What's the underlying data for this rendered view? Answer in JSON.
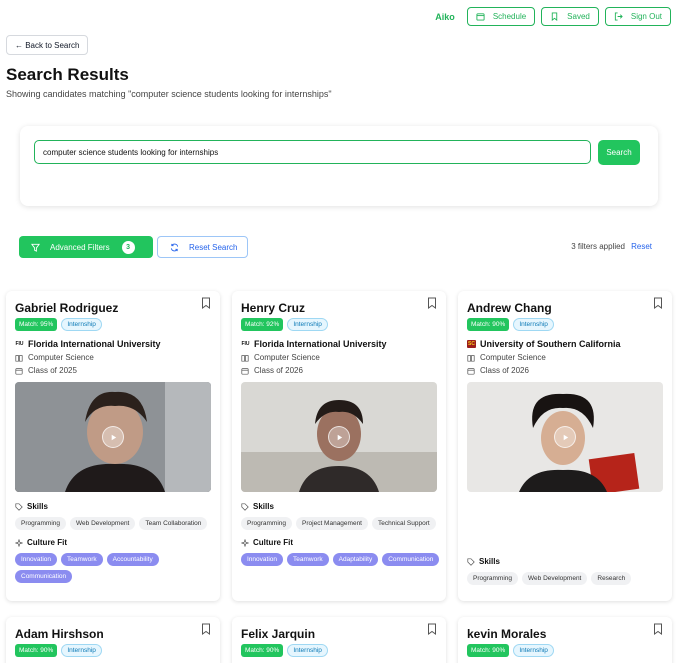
{
  "header": {
    "brand": "Aiko",
    "schedule_label": "Schedule",
    "saved_label": "Saved",
    "signout_label": "Sign Out"
  },
  "back_label": "← Back to Search",
  "page": {
    "title": "Search Results",
    "subtitle": "Showing candidates matching \"computer science students looking for internships\""
  },
  "search": {
    "value": "computer science students looking for internships",
    "button_label": "Search"
  },
  "filters": {
    "advanced_label": "Advanced Filters",
    "count": "3",
    "reset_label": "Reset Search",
    "applied_text": "3 filters applied",
    "reset_link": "Reset"
  },
  "labels": {
    "skills": "Skills",
    "culture": "Culture Fit"
  },
  "candidates": [
    {
      "name": "Gabriel Rodriguez",
      "match": "Match: 95%",
      "type": "Internship",
      "university": "Florida International University",
      "uni_logo": "FIU",
      "major": "Computer Science",
      "class_year": "Class of 2025",
      "skills": [
        "Programming",
        "Web Development",
        "Team Collaboration"
      ],
      "culture": [
        "Innovation",
        "Teamwork",
        "Accountability",
        "Communication"
      ]
    },
    {
      "name": "Henry Cruz",
      "match": "Match: 92%",
      "type": "Internship",
      "university": "Florida International University",
      "uni_logo": "FIU",
      "major": "Computer Science",
      "class_year": "Class of 2026",
      "skills": [
        "Programming",
        "Project Management",
        "Technical Support"
      ],
      "culture": [
        "Innovation",
        "Teamwork",
        "Adaptability",
        "Communication"
      ]
    },
    {
      "name": "Andrew Chang",
      "match": "Match: 90%",
      "type": "Internship",
      "university": "University of Southern California",
      "uni_logo": "SC",
      "major": "Computer Science",
      "class_year": "Class of 2026",
      "skills": [
        "Programming",
        "Web Development",
        "Research"
      ],
      "culture": []
    },
    {
      "name": "Adam Hirshson",
      "match": "Match: 90%",
      "type": "Internship"
    },
    {
      "name": "Felix Jarquin",
      "match": "Match: 90%",
      "type": "Internship"
    },
    {
      "name": "kevin Morales",
      "match": "Match: 90%",
      "type": "Internship"
    }
  ],
  "colors": {
    "accent": "#22c55e",
    "link": "#2563eb",
    "culture_tag": "#8b8cf0"
  }
}
